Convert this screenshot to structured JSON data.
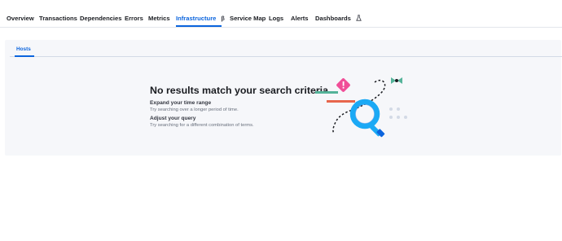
{
  "nav": {
    "tabs": [
      {
        "label": "Overview"
      },
      {
        "label": "Transactions"
      },
      {
        "label": "Dependencies"
      },
      {
        "label": "Errors"
      },
      {
        "label": "Metrics"
      },
      {
        "label": "Infrastructure",
        "active": true
      },
      {
        "label": "Service Map"
      },
      {
        "label": "Logs"
      },
      {
        "label": "Alerts"
      },
      {
        "label": "Dashboards"
      }
    ],
    "infrastructure_badge_icon": "beta-icon",
    "dashboards_badge_icon": "flask-icon"
  },
  "subnav": {
    "hosts_label": "Hosts"
  },
  "empty_state": {
    "title": "No results match your search criteria",
    "tips": [
      {
        "heading": "Expand your time range",
        "text": "Try searching over a longer period of time."
      },
      {
        "heading": "Adjust your query",
        "text": "Try searching for a different combination of terms."
      }
    ],
    "illustration": "magnifying-glass-illustration"
  },
  "colors": {
    "accent": "#0b64dd",
    "panel_bg": "#f6f7fa",
    "glass_blue": "#1ba9f5",
    "teal": "#54b399",
    "pink": "#f04e98",
    "orange": "#e7664c"
  }
}
